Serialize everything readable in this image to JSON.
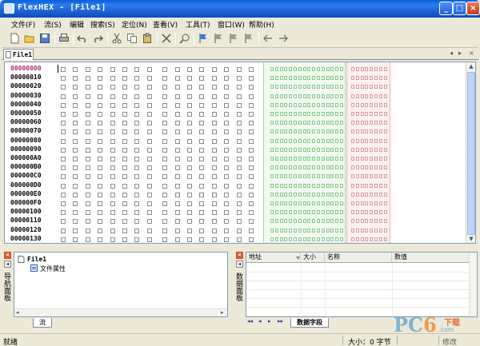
{
  "window": {
    "title": "FlexHEX - [File1]"
  },
  "menu": [
    {
      "label": "文件(F)"
    },
    {
      "label": "流(S)"
    },
    {
      "label": "编辑"
    },
    {
      "label": "搜索(S)"
    },
    {
      "label": "定位(N)"
    },
    {
      "label": "查看(V)"
    },
    {
      "label": "工具(T)"
    },
    {
      "label": "窗口(W)"
    },
    {
      "label": "帮助(H)"
    }
  ],
  "toolbar": {
    "icons": [
      "new-file-icon",
      "open-folder-icon",
      "save-icon",
      "print-icon",
      "undo-icon",
      "redo-icon",
      "cut-icon",
      "copy-icon",
      "paste-icon",
      "delete-icon",
      "find-icon",
      "bookmark-flag-icon",
      "bookmark-prev-icon",
      "bookmark-next-icon",
      "bookmark-clear-icon",
      "back-arrow-icon",
      "forward-arrow-icon"
    ]
  },
  "tabs": {
    "active": "File1"
  },
  "editor": {
    "addresses": [
      "00000000",
      "00000010",
      "00000020",
      "00000030",
      "00000040",
      "00000050",
      "00000060",
      "00000070",
      "00000080",
      "00000090",
      "000000A0",
      "000000B0",
      "000000C0",
      "000000D0",
      "000000E0",
      "000000F0",
      "00000100",
      "00000110",
      "00000120",
      "00000130"
    ],
    "active_address": "00000000"
  },
  "left_panel": {
    "side_label": "导航面板",
    "tree": {
      "root": "File1",
      "child": "文件属性"
    },
    "tab": "流"
  },
  "right_panel": {
    "side_label": "数据面板",
    "columns": [
      "地址",
      "大小",
      "名称",
      "数值"
    ],
    "tab": "数据字段"
  },
  "status": {
    "ready": "就绪",
    "size": "大小：0 字节",
    "extra": "修改"
  },
  "watermark": {
    "pc": "PC",
    "six": "6",
    "sub": "下载",
    "com": ".com"
  }
}
